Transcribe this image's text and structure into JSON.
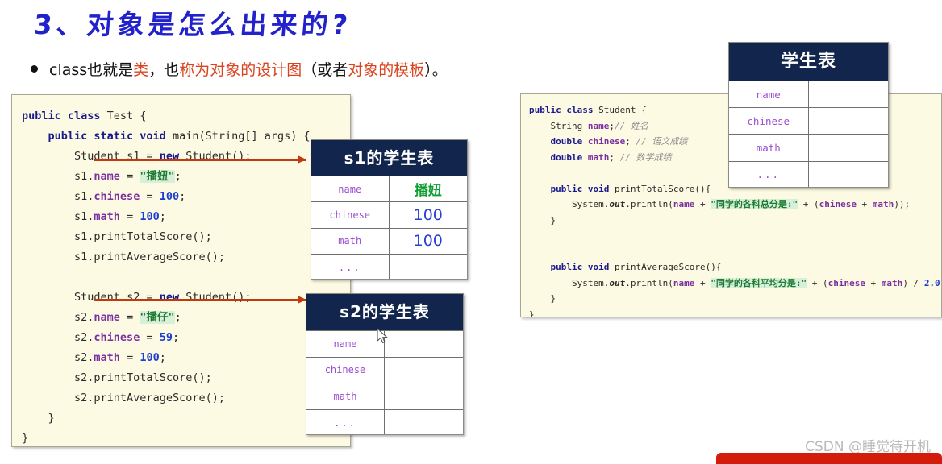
{
  "slide": {
    "title": "3、对象是怎么出来的?",
    "bullet": {
      "bullet_glyph": "bullet-dot",
      "seg1": "class也就是",
      "seg2_hl": "类",
      "seg3": "，也",
      "seg4_hl": "称为对象的设计图",
      "seg5": "（或者",
      "seg6_hl": "对象的模板",
      "seg7": "）。"
    },
    "accent_color": "#d9441f",
    "title_color": "#2222cc"
  },
  "code_left": {
    "lines": [
      "public class Test {",
      "    public static void main(String[] args) {",
      "        Student s1 = new Student();",
      "        s1.name = \"播妞\";",
      "        s1.chinese = 100;",
      "        s1.math = 100;",
      "        s1.printTotalScore();",
      "        s1.printAverageScore();",
      "",
      "        Student s2 = new Student();",
      "        s2.name = \"播仔\";",
      "        s2.chinese = 59;",
      "        s2.math = 100;",
      "        s2.printTotalScore();",
      "        s2.printAverageScore();",
      "    }",
      "}"
    ],
    "l1_kw1": "public class",
    "l1_name": " Test {",
    "l2_kw": "public static void",
    "l2_rest": " main(String[] args) {",
    "l3_type": "Student",
    "l3_var": " s1 = ",
    "l3_new": "new",
    "l3_rest": " Student();",
    "l4_obj": "s1.",
    "l4_fld": "name",
    "l4_eq": " = ",
    "l4_str": "\"播妞\"",
    "l4_end": ";",
    "l5_obj": "s1.",
    "l5_fld": "chinese",
    "l5_eq": " = ",
    "l5_num": "100",
    "l5_end": ";",
    "l6_obj": "s1.",
    "l6_fld": "math",
    "l6_eq": " = ",
    "l6_num": "100",
    "l6_end": ";",
    "l7": "s1.printTotalScore();",
    "l8": "s1.printAverageScore();",
    "l10_type": "Student",
    "l10_var": " s2 = ",
    "l10_new": "new",
    "l10_rest": " Student();",
    "l11_obj": "s2.",
    "l11_fld": "name",
    "l11_eq": " = ",
    "l11_str": "\"播仔\"",
    "l11_end": ";",
    "l12_obj": "s2.",
    "l12_fld": "chinese",
    "l12_eq": " = ",
    "l12_num": "59",
    "l12_end": ";",
    "l13_obj": "s2.",
    "l13_fld": "math",
    "l13_eq": " = ",
    "l13_num": "100",
    "l13_end": ";",
    "l14": "s2.printTotalScore();",
    "l15": "s2.printAverageScore();",
    "l16": "}",
    "l17": "}"
  },
  "code_right": {
    "r1_kw": "public class",
    "r1_name": " Student {",
    "r2_type": "String",
    "r2_fld": " name",
    "r2_semi": ";",
    "r2_cmt": "// 姓名",
    "r3_type": "double",
    "r3_fld": " chinese",
    "r3_semi": "; ",
    "r3_cmt": "// 语文成绩",
    "r4_type": "double",
    "r4_fld": " math",
    "r4_semi": "; ",
    "r4_cmt": "// 数学成绩",
    "r5_kw": "public void",
    "r5_rest": " printTotalScore(){",
    "r6_sys": "System.",
    "r6_out": "out",
    "r6_println": ".println(",
    "r6_name": "name",
    "r6_plus": " + ",
    "r6_str": "\"同学的各科总分是:\"",
    "r6_plus2": " + (",
    "r6_c": "chinese",
    "r6_op": " + ",
    "r6_m": "math",
    "r6_end": "));",
    "r7": "}",
    "r8_kw": "public void",
    "r8_rest": " printAverageScore(){",
    "r9_sys": "System.",
    "r9_out": "out",
    "r9_println": ".println(",
    "r9_name": "name",
    "r9_plus": " + ",
    "r9_str": "\"同学的各科平均分是:\"",
    "r9_plus2": " + (",
    "r9_c": "chinese",
    "r9_op": " + ",
    "r9_m": "math",
    "r9_div": ") / ",
    "r9_num": "2.0",
    "r9_end": ");",
    "r10": "}",
    "r11": "}"
  },
  "table_s1": {
    "title": "s1的学生表",
    "rows": [
      {
        "key": "name",
        "value": "播妞",
        "value_kind": "name"
      },
      {
        "key": "chinese",
        "value": "100",
        "value_kind": "num"
      },
      {
        "key": "math",
        "value": "100",
        "value_kind": "num"
      },
      {
        "key": "...",
        "value": "",
        "value_kind": "none"
      }
    ],
    "header_color": "#12264d"
  },
  "table_s2": {
    "title": "s2的学生表",
    "rows": [
      {
        "key": "name",
        "value": "",
        "value_kind": "none"
      },
      {
        "key": "chinese",
        "value": "",
        "value_kind": "none"
      },
      {
        "key": "math",
        "value": "",
        "value_kind": "none"
      },
      {
        "key": "...",
        "value": "",
        "value_kind": "none"
      }
    ],
    "header_color": "#12264d"
  },
  "table_class": {
    "title": "学生表",
    "rows": [
      {
        "key": "name",
        "value": "",
        "value_kind": "none"
      },
      {
        "key": "chinese",
        "value": "",
        "value_kind": "none"
      },
      {
        "key": "math",
        "value": "",
        "value_kind": "none"
      },
      {
        "key": "...",
        "value": "",
        "value_kind": "none"
      }
    ],
    "header_color": "#12264d"
  },
  "arrows": {
    "s1_label": "arrow-to-s1-table",
    "s2_label": "arrow-to-s2-table",
    "color": "#c0390f"
  },
  "watermark": {
    "text": "CSDN @睡觉待开机"
  }
}
